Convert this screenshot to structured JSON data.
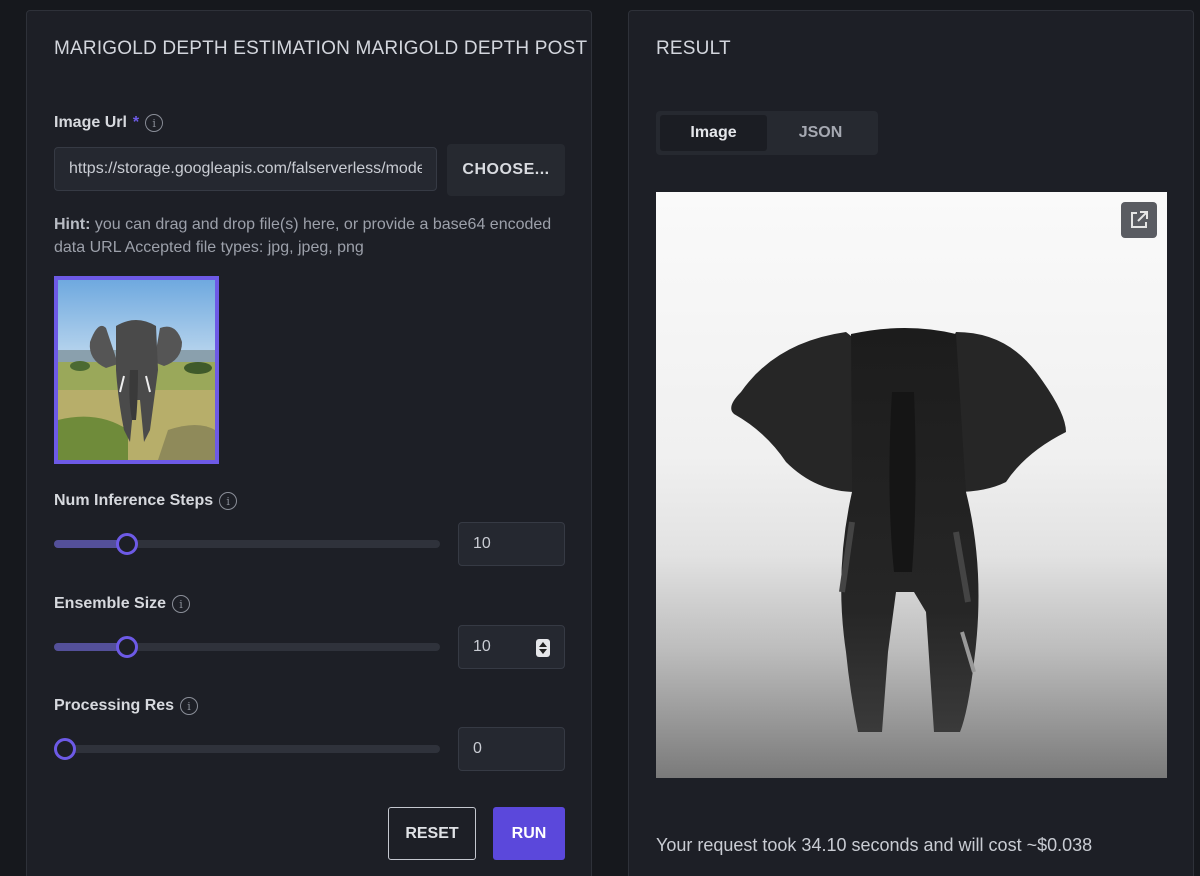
{
  "form": {
    "title": "MARIGOLD DEPTH ESTIMATION MARIGOLD DEPTH POST",
    "image_url": {
      "label": "Image Url",
      "required_mark": "*",
      "value": "https://storage.googleapis.com/falserverless/model_tests/marigold/elephant.jpg",
      "choose_label": "CHOOSE...",
      "hint_prefix": "Hint:",
      "hint_text": " you can drag and drop file(s) here, or provide a base64 encoded data URL Accepted file types: jpg, jpeg, png"
    },
    "num_inference_steps": {
      "label": "Num Inference Steps",
      "value": "10",
      "slider_fraction": 0.19
    },
    "ensemble_size": {
      "label": "Ensemble Size",
      "value": "10",
      "slider_fraction": 0.19
    },
    "processing_res": {
      "label": "Processing Res",
      "value": "0",
      "slider_fraction": 0.0
    },
    "reset_label": "RESET",
    "run_label": "RUN"
  },
  "result": {
    "title": "RESULT",
    "tabs": [
      "Image",
      "JSON"
    ],
    "active_tab": "Image",
    "summary": "Your request took 34.10 seconds and will cost ~$0.038"
  },
  "colors": {
    "accent": "#6d5ae6",
    "run_button": "#5b48db",
    "panel_bg": "#1d1f26",
    "page_bg": "#16181d"
  },
  "icons": {
    "info": "info-icon",
    "open_external": "external-link-icon",
    "spinner": "number-spinner-icon"
  }
}
